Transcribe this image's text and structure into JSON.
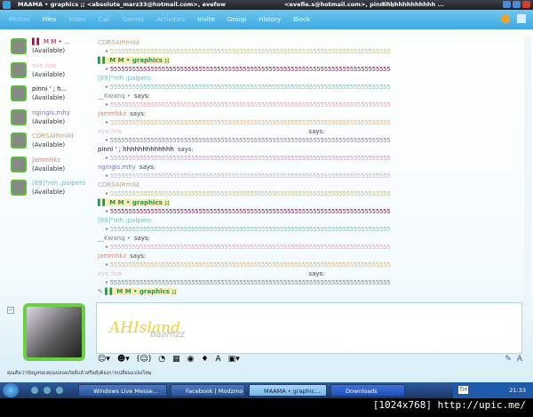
{
  "window": {
    "title": "MAAMA • graphics ;; <absolute_marz33@hotmail.com>, evefow",
    "title_mid": "<evefie.s@hotmail.com>, pinni ' ;",
    "title_right": "hhhhhhhhhhhhh ..."
  },
  "nav": {
    "items": [
      {
        "label": "Photos",
        "enabled": false
      },
      {
        "label": "Files",
        "enabled": true
      },
      {
        "label": "Video",
        "enabled": false
      },
      {
        "label": "Call",
        "enabled": false
      },
      {
        "label": "Games",
        "enabled": false
      },
      {
        "label": "Activities",
        "enabled": false
      },
      {
        "label": "Invite",
        "enabled": true
      },
      {
        "label": "Group",
        "enabled": true
      },
      {
        "label": "History",
        "enabled": true
      },
      {
        "label": "Block",
        "enabled": true
      }
    ]
  },
  "contacts": [
    {
      "name": "▌▌ M  M  • ...",
      "status": "(Available)",
      "color": "#9a1040"
    },
    {
      "name": "eve.fow",
      "status": "(Available)",
      "color": "#f0b8c8"
    },
    {
      "name": "pinni ' ;      h...",
      "status": "(Available)",
      "color": "#111111"
    },
    {
      "name": "ngingis.mhy",
      "status": "(Available)",
      "color": "#7a78b8"
    },
    {
      "name": "CORSAIRmild",
      "status": "(Available)",
      "color": "#c8a070"
    },
    {
      "name": "Jammhkz",
      "status": "(Available)",
      "color": "#e08070"
    },
    {
      "name": "[69]°mh ;palpero",
      "status": "(Available)",
      "color": "#60c0d0"
    }
  ],
  "chat": {
    "says": "says:",
    "body": "5555555555555555555555555555555555555555555555555555555555555555555555555555",
    "messages": [
      {
        "sender": "CORSAIRmild",
        "color": "#c8a070",
        "msgcolor": "#b8d060",
        "says": false
      },
      {
        "sender": "▌▌ M  M  • graphics ;;",
        "color": "#2a9060",
        "msgcolor": "#a01060",
        "says": false,
        "hl": true
      },
      {
        "sender": "[69]°mh ;palpero",
        "color": "#60c0d0",
        "msgcolor": "#70c8c0",
        "says": false
      },
      {
        "sender": "__Kwanq                         •",
        "color": "#888888",
        "msgcolor": "#f0a0a8",
        "says": true
      },
      {
        "sender": "Jammhkz",
        "color": "#e08070",
        "msgcolor": "#f0b060",
        "says": true
      },
      {
        "sender": "eve.fow",
        "color": "#f0b8c8",
        "msgcolor": "#888888",
        "says": true,
        "far": true
      },
      {
        "sender": "pinni ' ;          hhhhhhhhhhhhh",
        "color": "#111111",
        "msgcolor": "#e090c8",
        "says": true
      },
      {
        "sender": "ngingis.mhy",
        "color": "#7a78b8",
        "msgcolor": "#c8b0e0",
        "says": true
      },
      {
        "sender": "CORSAIRmild",
        "color": "#c8a070",
        "msgcolor": "#b8d060",
        "says": false
      },
      {
        "sender": "▌▌ M  M  • graphics ;;",
        "color": "#2a9060",
        "msgcolor": "#a01060",
        "says": false,
        "hl": true
      },
      {
        "sender": "[69]°mh ;palpero",
        "color": "#60c0d0",
        "msgcolor": "#70c8c0",
        "says": false
      },
      {
        "sender": "__Kwanq                         •",
        "color": "#888888",
        "msgcolor": "#f0a0a8",
        "says": true
      },
      {
        "sender": "Jammhkz",
        "color": "#e08070",
        "msgcolor": "#f0b060",
        "says": true
      },
      {
        "sender": "eve.fow",
        "color": "#f0b8c8",
        "msgcolor": "#888888",
        "says": true,
        "far": true
      }
    ],
    "typing": "▌▌ M  M  • graphics ;;"
  },
  "input": {
    "handwriting": "AHIsland",
    "handwriting_sub": "baamzz"
  },
  "status_text": "คุณคิดว่าข้อมูลของคุณปลอดภัยดีแล้วหรือยังต้องการเปลี่ยนแปลงไหม",
  "taskbar": {
    "tasks": [
      {
        "label": "Windows Live Messe..."
      },
      {
        "label": "Facebook | Modzmo ..."
      },
      {
        "label": "MAAMA • graphic..."
      },
      {
        "label": "Downloads"
      }
    ],
    "lang": "TH",
    "clock": "21:33"
  },
  "watermark": "[1024x768] http://upic.me/"
}
